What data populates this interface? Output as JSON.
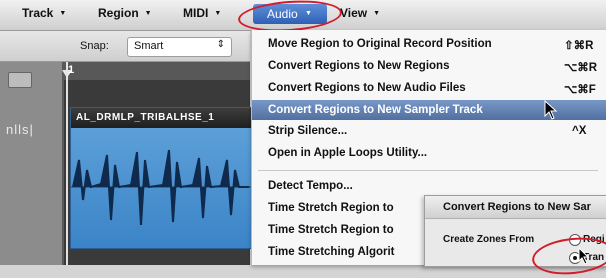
{
  "menubar": {
    "items": [
      {
        "label": "Track"
      },
      {
        "label": "Region"
      },
      {
        "label": "MIDI"
      },
      {
        "label": "Audio"
      },
      {
        "label": "View"
      }
    ]
  },
  "toolbar": {
    "snap_label": "Snap:",
    "snap_value": "Smart"
  },
  "arrange": {
    "ruler_number": "1",
    "track_label": "nlls|",
    "region_name": "AL_DRMLP_TRIBALHSE_1"
  },
  "audio_menu": {
    "items": [
      {
        "label": "Move Region to Original Record Position",
        "shortcut": "⇧⌘R"
      },
      {
        "label": "Convert Regions to New Regions",
        "shortcut": "⌥⌘R"
      },
      {
        "label": "Convert Regions to New Audio Files",
        "shortcut": "⌥⌘F"
      },
      {
        "label": "Convert Regions to New Sampler Track",
        "shortcut": ""
      },
      {
        "label": "Strip Silence...",
        "shortcut": "^X"
      },
      {
        "label": "Open in Apple Loops Utility...",
        "shortcut": ""
      },
      {
        "label": "Detect Tempo...",
        "shortcut": ""
      },
      {
        "label": "Time Stretch Region to",
        "shortcut": ""
      },
      {
        "label": "Time Stretch Region to",
        "shortcut": ""
      },
      {
        "label": "Time Stretching Algorit",
        "shortcut": ""
      }
    ],
    "highlighted_index": 3
  },
  "dialog": {
    "title": "Convert Regions to New Sar",
    "create_zones_label": "Create Zones From",
    "option_1": "Regi",
    "option_2": "Tran"
  }
}
